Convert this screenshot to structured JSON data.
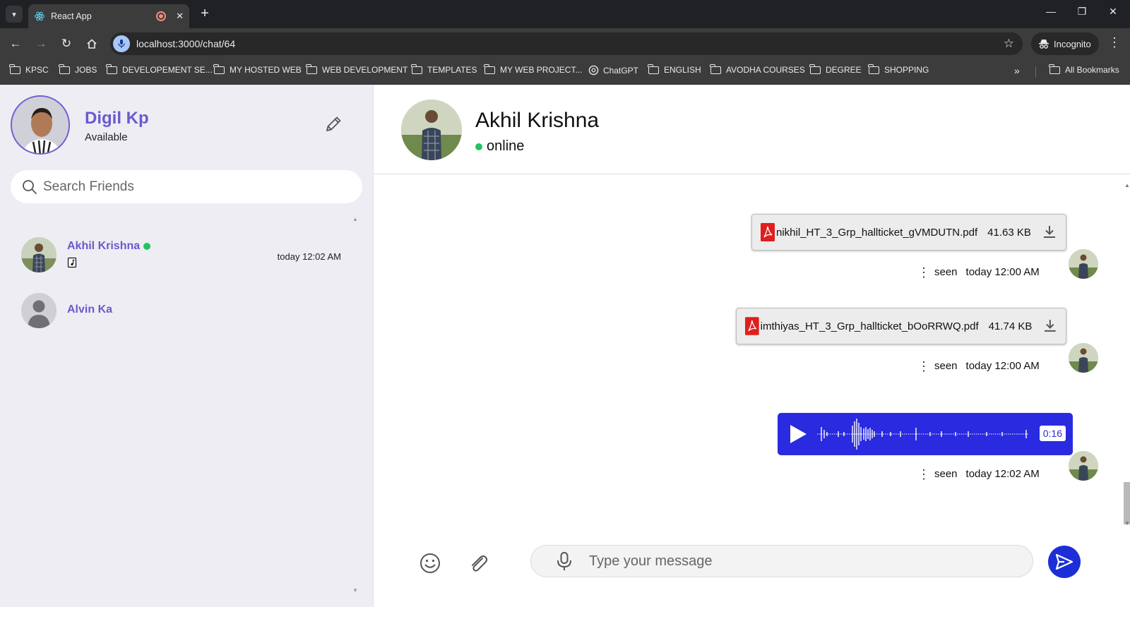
{
  "browser": {
    "tab_title": "React App",
    "url": "localhost:3000/chat/64",
    "incognito_label": "Incognito",
    "bookmarks": [
      "KPSC",
      "JOBS",
      "DEVELOPEMENT SE...",
      "MY HOSTED WEB",
      "WEB DEVELOPMENT",
      "TEMPLATES",
      "MY WEB PROJECT...",
      "ChatGPT",
      "ENGLISH",
      "AVODHA COURSES",
      "DEGREE",
      "SHOPPING"
    ],
    "all_bookmarks_label": "All Bookmarks"
  },
  "profile": {
    "name": "Digil Kp",
    "status": "Available"
  },
  "search": {
    "placeholder": "Search Friends"
  },
  "friends": [
    {
      "name": "Akhil Krishna",
      "online": true,
      "time": "today 12:02 AM"
    },
    {
      "name": "Alvin Ka",
      "online": false,
      "time": ""
    }
  ],
  "chat_header": {
    "name": "Akhil Krishna",
    "status": "online"
  },
  "messages": [
    {
      "type": "file",
      "filename": "nikhil_HT_3_Grp_hallticket_gVMDUTN.pdf",
      "size": "41.63 KB",
      "status": "seen",
      "time": "today 12:00 AM"
    },
    {
      "type": "file",
      "filename": "imthiyas_HT_3_Grp_hallticket_bOoRRWQ.pdf",
      "size": "41.74 KB",
      "status": "seen",
      "time": "today 12:00 AM"
    },
    {
      "type": "voice",
      "duration": "0:16",
      "status": "seen",
      "time": "today 12:02 AM"
    }
  ],
  "composer": {
    "placeholder": "Type your message"
  },
  "colors": {
    "accent": "#6a5acd",
    "online": "#22c55e",
    "voice_bubble": "#2a2ae0",
    "send_button": "#1c2fd6"
  }
}
